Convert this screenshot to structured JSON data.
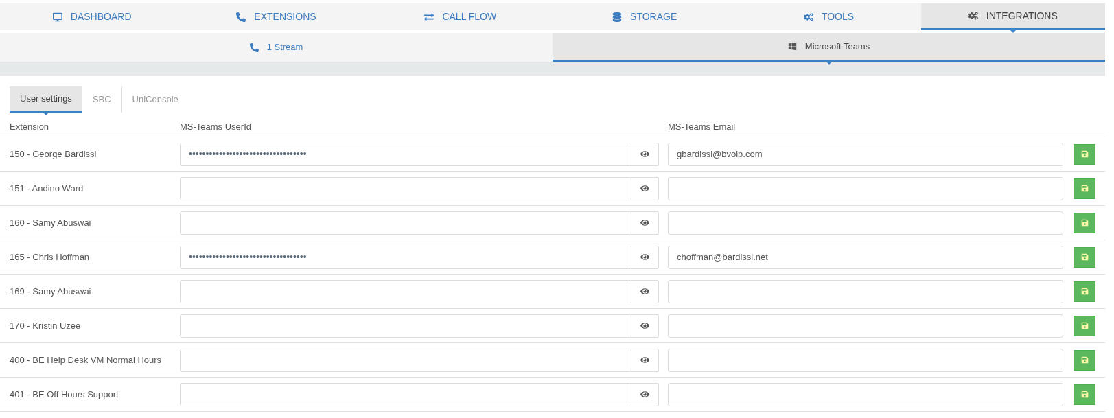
{
  "main_nav": [
    {
      "label": "DASHBOARD",
      "selected": false
    },
    {
      "label": "EXTENSIONS",
      "selected": false
    },
    {
      "label": "CALL FLOW",
      "selected": false
    },
    {
      "label": "STORAGE",
      "selected": false
    },
    {
      "label": "TOOLS",
      "selected": false
    },
    {
      "label": "INTEGRATIONS",
      "selected": true
    }
  ],
  "sub_nav": [
    {
      "label": "1 Stream",
      "selected": false
    },
    {
      "label": "Microsoft Teams",
      "selected": true
    }
  ],
  "tabs": [
    {
      "label": "User settings",
      "selected": true
    },
    {
      "label": "SBC",
      "selected": false
    },
    {
      "label": "UniConsole",
      "selected": false
    }
  ],
  "table": {
    "columns": [
      "Extension",
      "MS-Teams UserId",
      "MS-Teams Email"
    ],
    "rows": [
      {
        "extension": "150 - George Bardissi",
        "userid": "•••••••••••••••••••••••••••••••••••",
        "email": "gbardissi@bvoip.com"
      },
      {
        "extension": "151 - Andino Ward"
      },
      {
        "extension": "160 - Samy Abuswai"
      },
      {
        "extension": "165 - Chris Hoffman",
        "userid": "•••••••••••••••••••••••••••••••••••",
        "email": "choffman@bardissi.net"
      },
      {
        "extension": "169 - Samy Abuswai"
      },
      {
        "extension": "170 - Kristin Uzee"
      },
      {
        "extension": "400 - BE Help Desk VM Normal Hours"
      },
      {
        "extension": "401 - BE Off Hours Support"
      }
    ]
  }
}
